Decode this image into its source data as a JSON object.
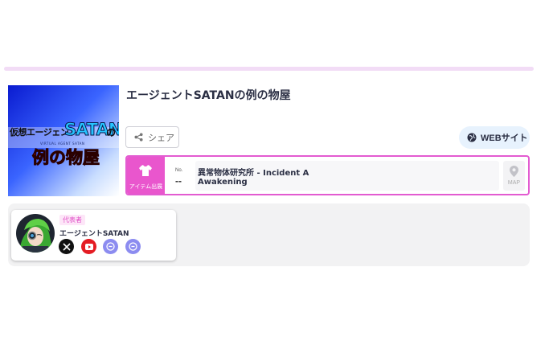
{
  "booth": {
    "thumbnail": {
      "line1": "仮想エージェント",
      "big": "SATAN",
      "no": "の",
      "small": "VIRTUAL AGENT SATAN",
      "red": "例の物屋"
    },
    "title": "エージェントSATANの例の物屋",
    "share_label": "シェア",
    "web_label": "WEBサイト"
  },
  "item": {
    "badge_label": "アイテム出展",
    "no_key": "No.",
    "no_value": "--",
    "name_line1": "異常物体研究所 - Incident A",
    "name_line2": "Awakening",
    "map_label": "MAP"
  },
  "member": {
    "role": "代表者",
    "name": "エージェントSATAN",
    "socials": [
      "x-icon",
      "youtube-icon",
      "link-icon",
      "link-icon"
    ]
  },
  "colors": {
    "accent_pink": "#e956cd",
    "web_button_bg": "#e7f2fd",
    "top_rule": "#f2dcf6"
  }
}
